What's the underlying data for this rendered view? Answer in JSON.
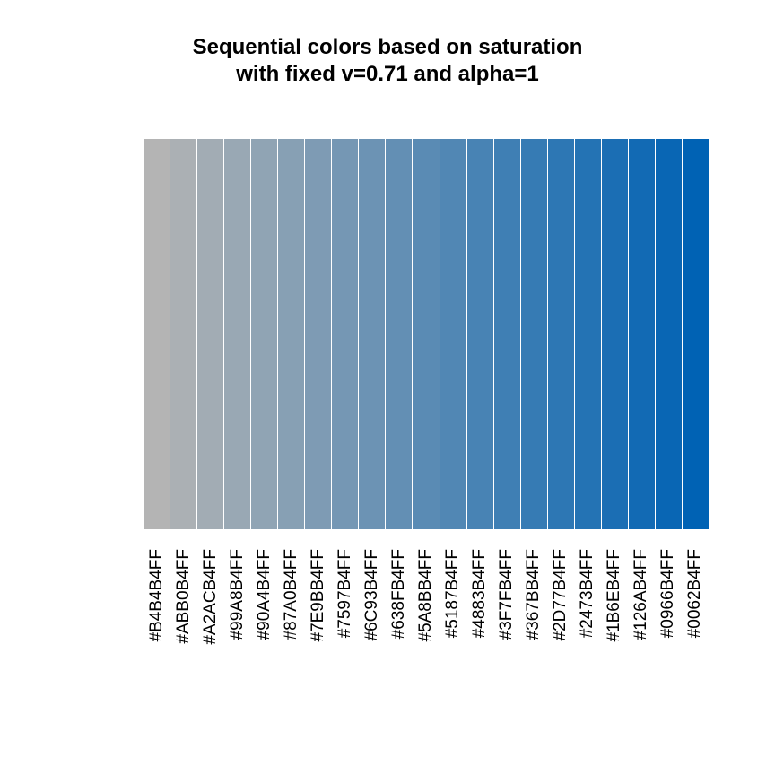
{
  "chart_data": {
    "type": "bar",
    "title": "Sequential colors based on saturation\nwith fixed v=0.71 and alpha=1",
    "title_lines": [
      "Sequential colors based on saturation",
      "with fixed v=0.71 and alpha=1"
    ],
    "xlabel": "",
    "ylabel": "",
    "categories": [
      "#B4B4B4FF",
      "#ABB0B4FF",
      "#A2ACB4FF",
      "#99A8B4FF",
      "#90A4B4FF",
      "#87A0B4FF",
      "#7E9BB4FF",
      "#7597B4FF",
      "#6C93B4FF",
      "#638FB4FF",
      "#5A8BB4FF",
      "#5187B4FF",
      "#4883B4FF",
      "#3F7FB4FF",
      "#367BB4FF",
      "#2D77B4FF",
      "#2473B4FF",
      "#1B6EB4FF",
      "#126AB4FF",
      "#0966B4FF",
      "#0062B4FF"
    ],
    "values": [
      1,
      1,
      1,
      1,
      1,
      1,
      1,
      1,
      1,
      1,
      1,
      1,
      1,
      1,
      1,
      1,
      1,
      1,
      1,
      1,
      1
    ],
    "colors": [
      "#B4B4B4",
      "#ABB0B4",
      "#A2ACB4",
      "#99A8B4",
      "#90A4B4",
      "#87A0B4",
      "#7E9BB4",
      "#7597B4",
      "#6C93B4",
      "#638FB4",
      "#5A8BB4",
      "#5187B4",
      "#4883B4",
      "#3F7FB4",
      "#367BB4",
      "#2D77B4",
      "#2473B4",
      "#1B6EB4",
      "#126AB4",
      "#0966B4",
      "#0062B4"
    ],
    "ylim": [
      0,
      1
    ]
  }
}
